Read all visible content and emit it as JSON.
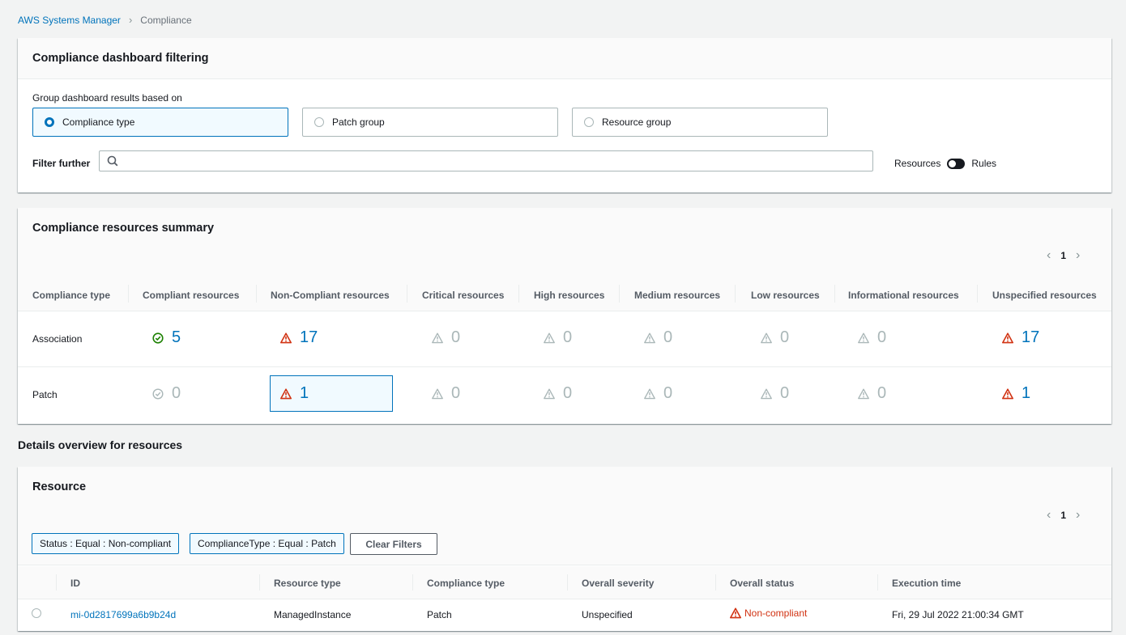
{
  "breadcrumb": {
    "root": "AWS Systems Manager",
    "current": "Compliance"
  },
  "filter_panel": {
    "title": "Compliance dashboard filtering",
    "group_label": "Group dashboard results based on",
    "options": [
      "Compliance type",
      "Patch group",
      "Resource group"
    ],
    "selected_option": "Compliance type",
    "filter_label": "Filter further",
    "search_value": "",
    "toggle_left": "Resources",
    "toggle_right": "Rules"
  },
  "summary_panel": {
    "title": "Compliance resources summary",
    "page": "1",
    "columns": [
      "Compliance type",
      "Compliant resources",
      "Non-Compliant resources",
      "Critical resources",
      "High resources",
      "Medium resources",
      "Low resources",
      "Informational resources",
      "Unspecified resources"
    ],
    "rows": [
      {
        "type": "Association",
        "compliant": "5",
        "noncompliant": "17",
        "critical": "0",
        "high": "0",
        "medium": "0",
        "low": "0",
        "informational": "0",
        "unspecified": "17"
      },
      {
        "type": "Patch",
        "compliant": "0",
        "noncompliant": "1",
        "critical": "0",
        "high": "0",
        "medium": "0",
        "low": "0",
        "informational": "0",
        "unspecified": "1"
      }
    ]
  },
  "details_title": "Details overview for resources",
  "resource_panel": {
    "title": "Resource",
    "page": "1",
    "filters": [
      "Status : Equal : Non-compliant",
      "ComplianceType : Equal : Patch"
    ],
    "clear_label": "Clear Filters",
    "columns": [
      "ID",
      "Resource type",
      "Compliance type",
      "Overall severity",
      "Overall status",
      "Execution time"
    ],
    "rows": [
      {
        "id": "mi-0d2817699a6b9b24d",
        "resource_type": "ManagedInstance",
        "compliance_type": "Patch",
        "severity": "Unspecified",
        "status": "Non-compliant",
        "execution_time": "Fri, 29 Jul 2022 21:00:34 GMT"
      }
    ]
  },
  "colors": {
    "link": "#0073bb",
    "compliant": "#1d8102",
    "warning": "#d13212",
    "muted": "#aab7b8"
  }
}
